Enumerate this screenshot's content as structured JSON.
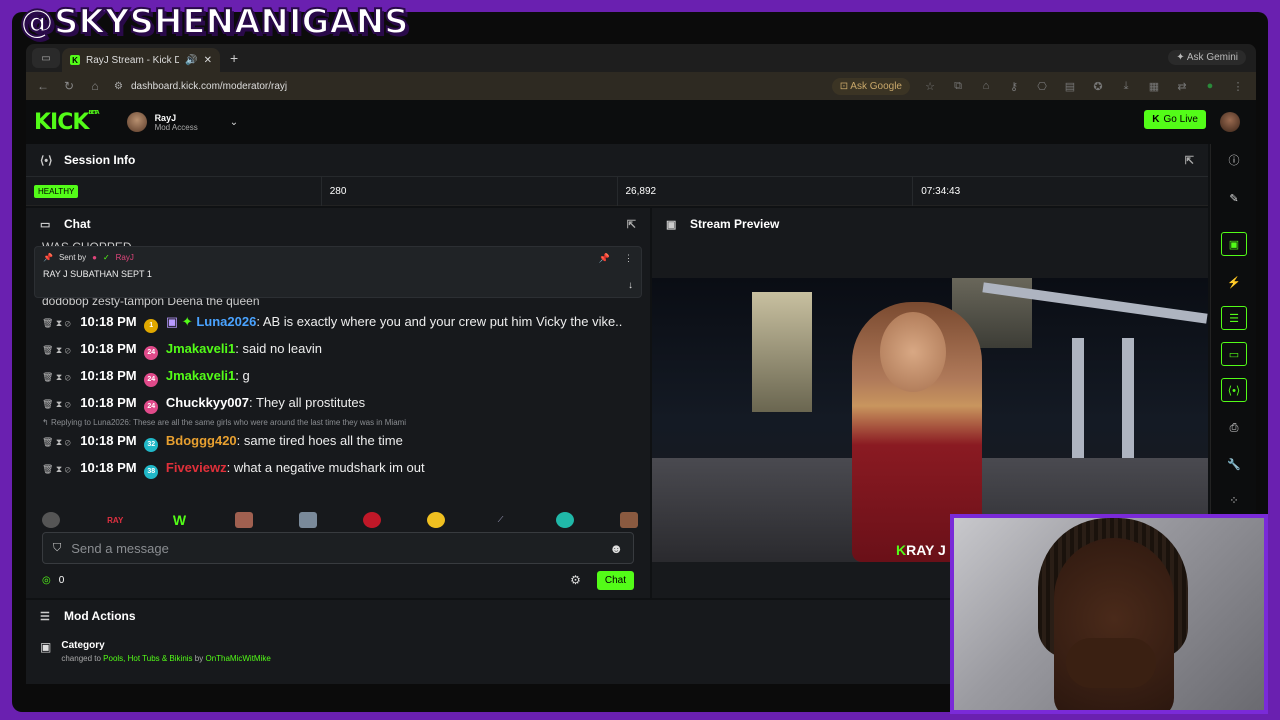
{
  "overlay": {
    "handle": "@SKYSHENANIGANS"
  },
  "browser": {
    "tab_title": "RayJ Stream - Kick Dashb",
    "url": "dashboard.kick.com/moderator/rayj",
    "ask_google": "Ask Google",
    "ask_gemini": "Ask Gemini"
  },
  "kick": {
    "logo": "KICK",
    "logo_sup": "BETA",
    "user_name": "RayJ",
    "user_access": "Mod Access",
    "go_live": "Go Live"
  },
  "session": {
    "title": "Session Info",
    "health": "HEALTHY",
    "viewers": "280",
    "followers": "26,892",
    "uptime": "07:34:43"
  },
  "chat": {
    "title": "Chat",
    "cut_top": "WAS CHOPPED",
    "cut_mid": "dodobop zesty-tampon Deena the queen",
    "pinned": {
      "sent_by": "Sent by",
      "author": "RayJ",
      "text": "RAY J SUBATHAN SEPT 1"
    },
    "messages": [
      {
        "time": "10:18 PM",
        "user": "Luna2026",
        "text": "AB is exactly where you and your crew put him Vicky the vike..",
        "badge": "1"
      },
      {
        "time": "10:18 PM",
        "user": "Jmakaveli1",
        "text": "said no leavin",
        "badge": "24"
      },
      {
        "time": "10:18 PM",
        "user": "Jmakaveli1",
        "text": "g",
        "badge": "24"
      },
      {
        "time": "10:18 PM",
        "user": "Chuckkyy007",
        "text": "They all prostitutes",
        "badge": "24"
      },
      {
        "time": "10:18 PM",
        "user": "Bdoggg420",
        "text": "same tired hoes all the time",
        "badge": "32",
        "reply": "Replying to Luna2026: These are all the same girls who were around the last time they was in Miami"
      },
      {
        "time": "10:18 PM",
        "user": "Fiveviewz",
        "text": "what a negative mudshark im out",
        "badge": "38"
      }
    ],
    "placeholder": "Send a message",
    "count": "0",
    "chat_button": "Chat"
  },
  "preview": {
    "title": "Stream Preview",
    "watermark_k": "K",
    "watermark_text": "RAY J"
  },
  "mod_actions": {
    "title": "Mod Actions",
    "item_title": "Category",
    "changed_to": "changed to",
    "category": "Pools, Hot Tubs & Bikinis",
    "by": "by",
    "moderator": "OnThaMicWitMike"
  },
  "colors": {
    "kick_green": "#53fc18",
    "frame_purple": "#6a20b0",
    "panel": "#17191c"
  }
}
